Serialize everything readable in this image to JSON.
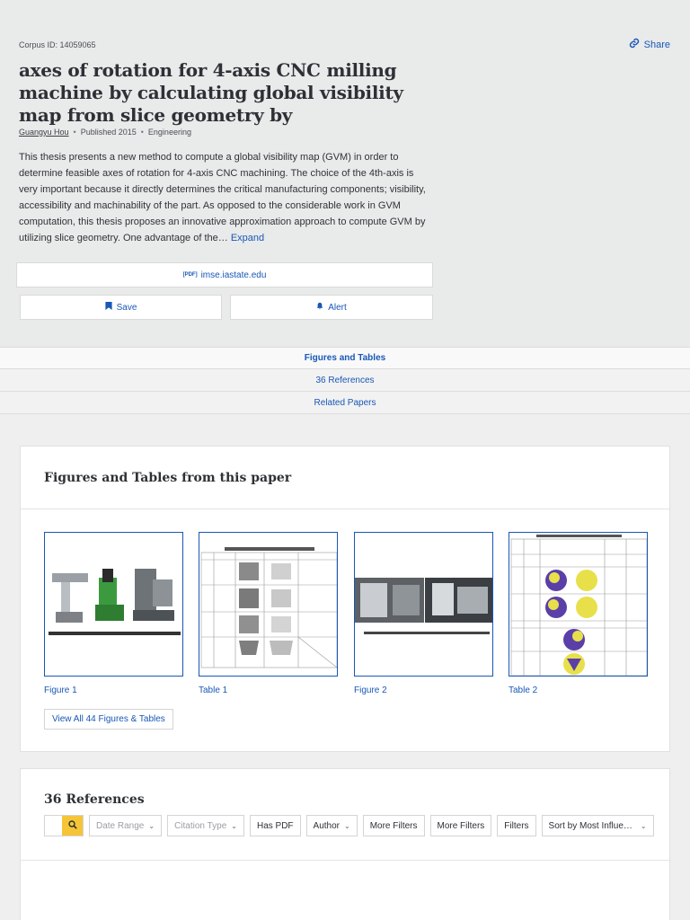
{
  "paper": {
    "corpus_id": "Corpus ID: 14059065",
    "share_label": "Share",
    "title": "axes of rotation for 4-axis CNC milling machine by calculating global visibility map from slice geometry by",
    "author": "Guangyu Hou",
    "published": "Published 2015",
    "field": "Engineering",
    "abstract": "This thesis presents a new method to compute a global visibility map (GVM) in order to determine feasible axes of rotation for 4-axis CNC machining. The choice of the 4th-axis is very important because it directly determines the critical manufacturing components; visibility, accessibility and machinability of the part. As opposed to the considerable work in GVM computation, this thesis proposes an innovative approximation approach to compute GVM by utilizing slice geometry. One advantage of the…",
    "expand_label": "Expand"
  },
  "actions": {
    "pdf_tag": "[PDF]",
    "pdf_source": "imse.iastate.edu",
    "save_label": "Save",
    "alert_label": "Alert"
  },
  "tabs": [
    {
      "label": "Figures and Tables",
      "active": true
    },
    {
      "label": "36 References",
      "active": false
    },
    {
      "label": "Related Papers",
      "active": false
    }
  ],
  "figures_section": {
    "title": "Figures and Tables from this paper",
    "items": [
      {
        "label": "Figure 1",
        "thumb": "milling-machines"
      },
      {
        "label": "Table 1",
        "thumb": "dimension-table"
      },
      {
        "label": "Figure 2",
        "thumb": "machine-photos"
      },
      {
        "label": "Table 2",
        "thumb": "visibility-table"
      }
    ],
    "view_all_label": "View All 44 Figures & Tables"
  },
  "references_section": {
    "title": "36 References",
    "filters": [
      {
        "label": "Date Range",
        "dropdown": true,
        "disabled": true
      },
      {
        "label": "Citation Type",
        "dropdown": true,
        "disabled": true
      },
      {
        "label": "Has PDF",
        "dropdown": false,
        "disabled": false
      },
      {
        "label": "Author",
        "dropdown": true,
        "disabled": false
      },
      {
        "label": "More Filters",
        "dropdown": false,
        "disabled": false
      },
      {
        "label": "More Filters",
        "dropdown": false,
        "disabled": false
      },
      {
        "label": "Filters",
        "dropdown": false,
        "disabled": false
      }
    ],
    "sort_label": "Sort by Most Influe…"
  },
  "colors": {
    "link": "#1857b6",
    "search_accent": "#f6c537",
    "header_bg": "#e9eaea"
  }
}
